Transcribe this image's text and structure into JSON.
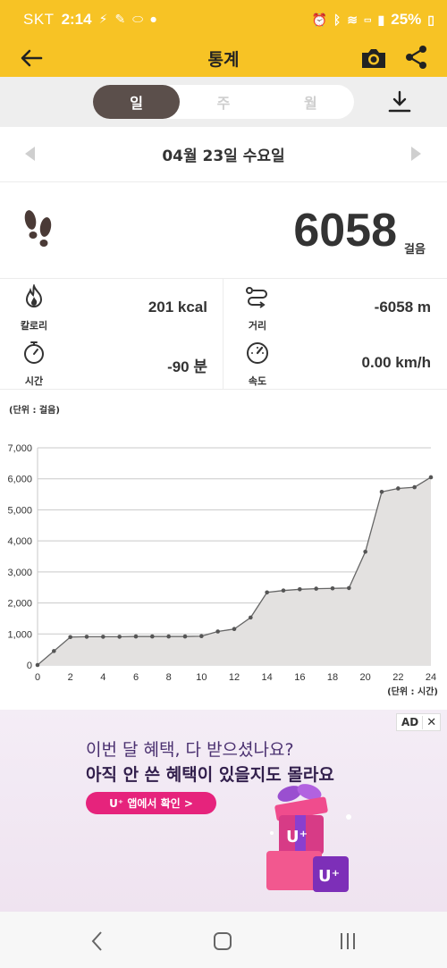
{
  "status_bar": {
    "carrier": "SKT",
    "time": "2:14",
    "battery": "25%"
  },
  "app_bar": {
    "title": "통계"
  },
  "tabs": [
    {
      "label": "일",
      "active": true
    },
    {
      "label": "주",
      "active": false
    },
    {
      "label": "월",
      "active": false
    }
  ],
  "date_nav": {
    "date": "04월 23일 수요일"
  },
  "steps": {
    "value": "6058",
    "unit": "걸음"
  },
  "stats": {
    "calories": {
      "label": "칼로리",
      "value": "201 kcal"
    },
    "distance": {
      "label": "거리",
      "value": "-6058 m"
    },
    "time": {
      "label": "시간",
      "value": "-90 분"
    },
    "speed": {
      "label": "속도",
      "value": "0.00 km/h"
    }
  },
  "chart_unit_label": "(단위 : 걸음)",
  "chart_data": {
    "type": "area",
    "xlabel": "(단위 : 시간)",
    "ylabel": "",
    "x": [
      0,
      1,
      2,
      3,
      4,
      5,
      6,
      7,
      8,
      9,
      10,
      11,
      12,
      13,
      14,
      15,
      16,
      17,
      18,
      19,
      20,
      21,
      22,
      23,
      24
    ],
    "values": [
      0,
      450,
      900,
      910,
      910,
      910,
      920,
      920,
      920,
      920,
      930,
      1080,
      1160,
      1530,
      2340,
      2400,
      2440,
      2460,
      2470,
      2480,
      3650,
      5580,
      5690,
      5730,
      6050
    ],
    "xlim": [
      0,
      24
    ],
    "ylim": [
      0,
      7000
    ],
    "x_ticks": [
      0,
      2,
      4,
      6,
      8,
      10,
      12,
      14,
      16,
      18,
      20,
      22,
      24
    ],
    "y_ticks": [
      0,
      1000,
      2000,
      3000,
      4000,
      5000,
      6000,
      7000
    ],
    "y_tick_labels": [
      "0",
      "1,000",
      "2,000",
      "3,000",
      "4,000",
      "5,000",
      "6,000",
      "7,000"
    ],
    "grid": true,
    "colors": {
      "fill": "#e3e1e0",
      "line": "#666666",
      "point": "#555555"
    }
  },
  "ad": {
    "badge": "AD",
    "close": "✕",
    "line1": "이번 달 혜택, 다 받으셨나요?",
    "line2": "아직 안 쓴 혜택이 있을지도 몰라요",
    "cta": "U⁺ 앱에서 확인  >",
    "gift_text": "U⁺"
  },
  "colors": {
    "brand_yellow": "#f7c325",
    "active_tab": "#5b4f4b",
    "ad_cta": "#e6237c"
  },
  "icons": {
    "back": "back-arrow-icon",
    "camera": "camera-icon",
    "share": "share-icon",
    "download": "download-icon",
    "steps": "footprints-icon",
    "calories": "flame-icon",
    "distance": "route-icon",
    "time": "stopwatch-icon",
    "speed": "speedometer-icon"
  }
}
